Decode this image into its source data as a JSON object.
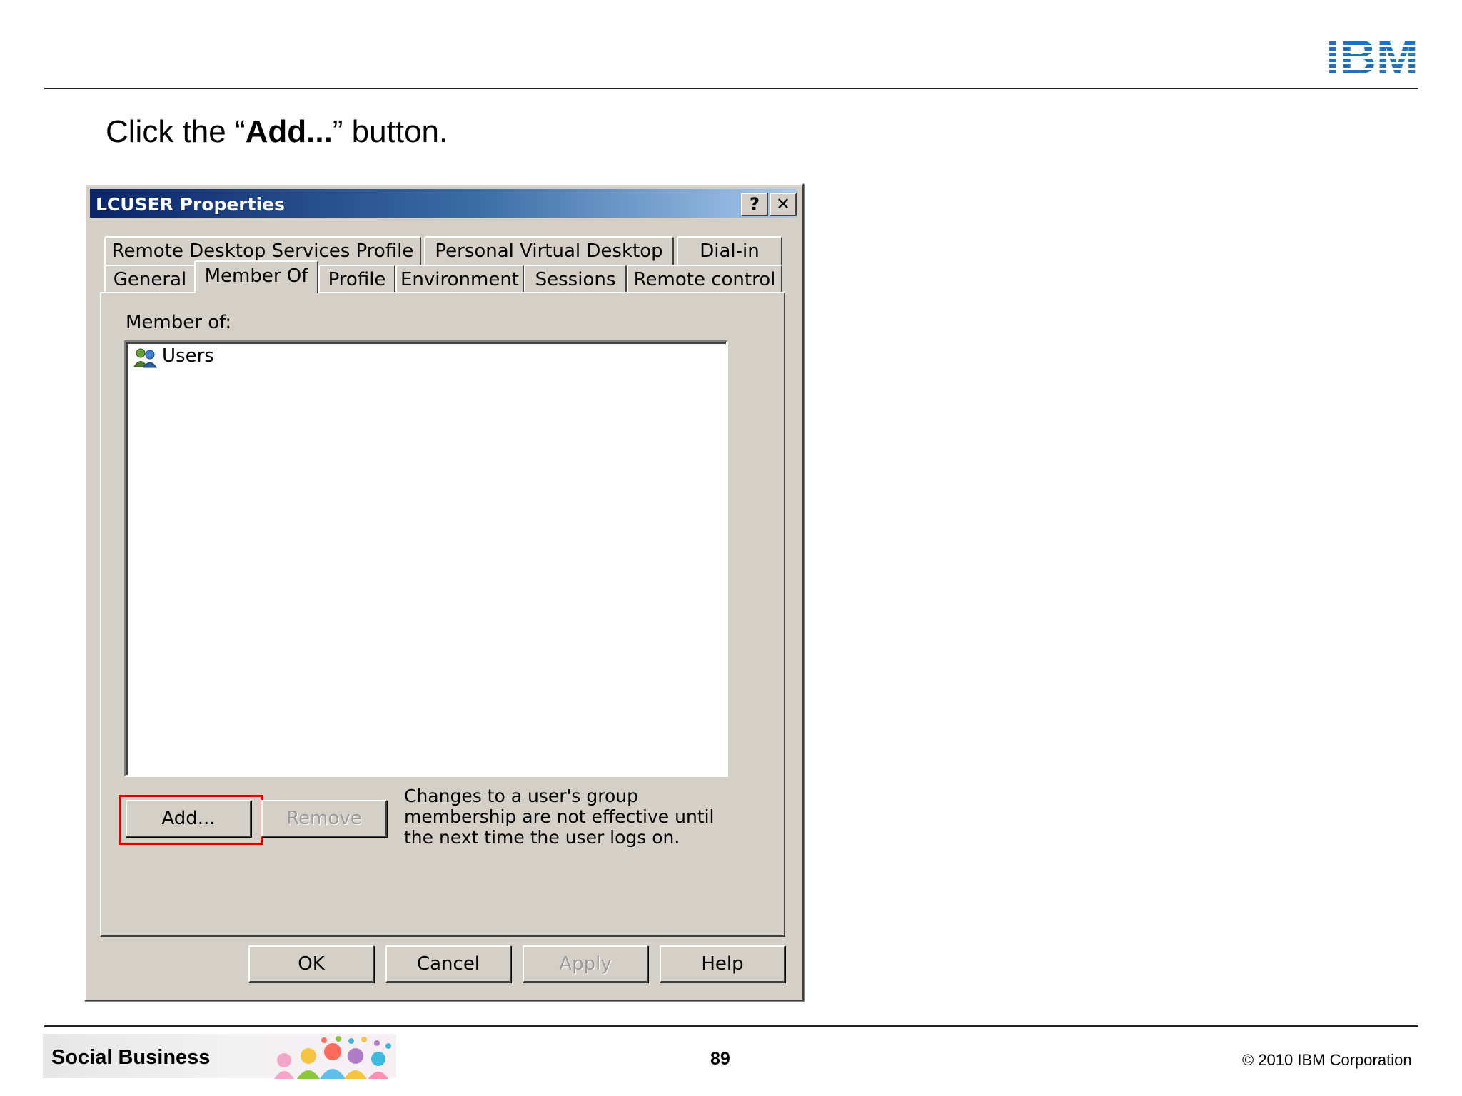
{
  "header": {
    "logo_text": "IBM",
    "instruction_prefix": "Click the “",
    "instruction_bold": "Add...",
    "instruction_suffix": "” button."
  },
  "dialog": {
    "title": "LCUSER Properties",
    "help_glyph": "?",
    "close_glyph": "✕",
    "tabs_row1": [
      "Remote Desktop Services Profile",
      "Personal Virtual Desktop",
      "Dial-in"
    ],
    "tabs_row2": [
      "General",
      "Member Of",
      "Profile",
      "Environment",
      "Sessions",
      "Remote control"
    ],
    "active_tab": "Member Of",
    "member_of_label": "Member of:",
    "members": [
      {
        "name": "Users",
        "icon": "group-icon"
      }
    ],
    "add_button": "Add...",
    "remove_button": "Remove",
    "note": "Changes to a user's group membership are not effective until the next time the user logs on.",
    "ok_button": "OK",
    "cancel_button": "Cancel",
    "apply_button": "Apply",
    "help_button": "Help"
  },
  "footer": {
    "brand": "Social Business",
    "page_number": "89",
    "copyright": "© 2010 IBM Corporation"
  },
  "colors": {
    "dialog_face": "#d4d0c8",
    "titlebar_start": "#0a246a",
    "titlebar_end": "#a6caf0",
    "highlight": "#e00000",
    "logo_blue": "#1f70c1"
  }
}
